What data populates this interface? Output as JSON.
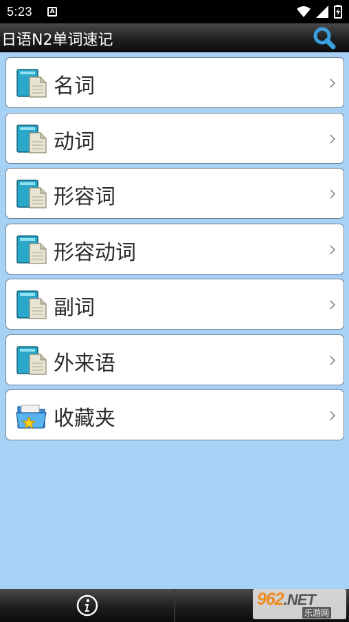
{
  "status_bar": {
    "time": "5:23",
    "notification_icon_letter": "A",
    "icons": [
      "notification-a-icon",
      "wifi-icon",
      "signal-icon",
      "battery-charging-icon"
    ]
  },
  "app": {
    "title": "日语N2单词速记",
    "search_icon": "search-icon"
  },
  "menu": {
    "items": [
      {
        "label": "名词",
        "icon": "book-icon"
      },
      {
        "label": "动词",
        "icon": "book-icon"
      },
      {
        "label": "形容词",
        "icon": "book-icon"
      },
      {
        "label": "形容动词",
        "icon": "book-icon"
      },
      {
        "label": "副词",
        "icon": "book-icon"
      },
      {
        "label": "外来语",
        "icon": "book-icon"
      },
      {
        "label": "收藏夹",
        "icon": "star-folder-icon"
      }
    ]
  },
  "bottom_bar": {
    "info_icon": "info-icon"
  },
  "watermark": {
    "brand_number": "962",
    "brand_suffix": ".NET",
    "subtitle": "乐游网"
  },
  "colors": {
    "background": "#a7d1f5",
    "bar_dark": "#1e1e1e",
    "card": "#ffffff",
    "accent_blue": "#3aa0e0",
    "book_teal": "#2aa7c9",
    "watermark_orange": "#f08a1a"
  }
}
